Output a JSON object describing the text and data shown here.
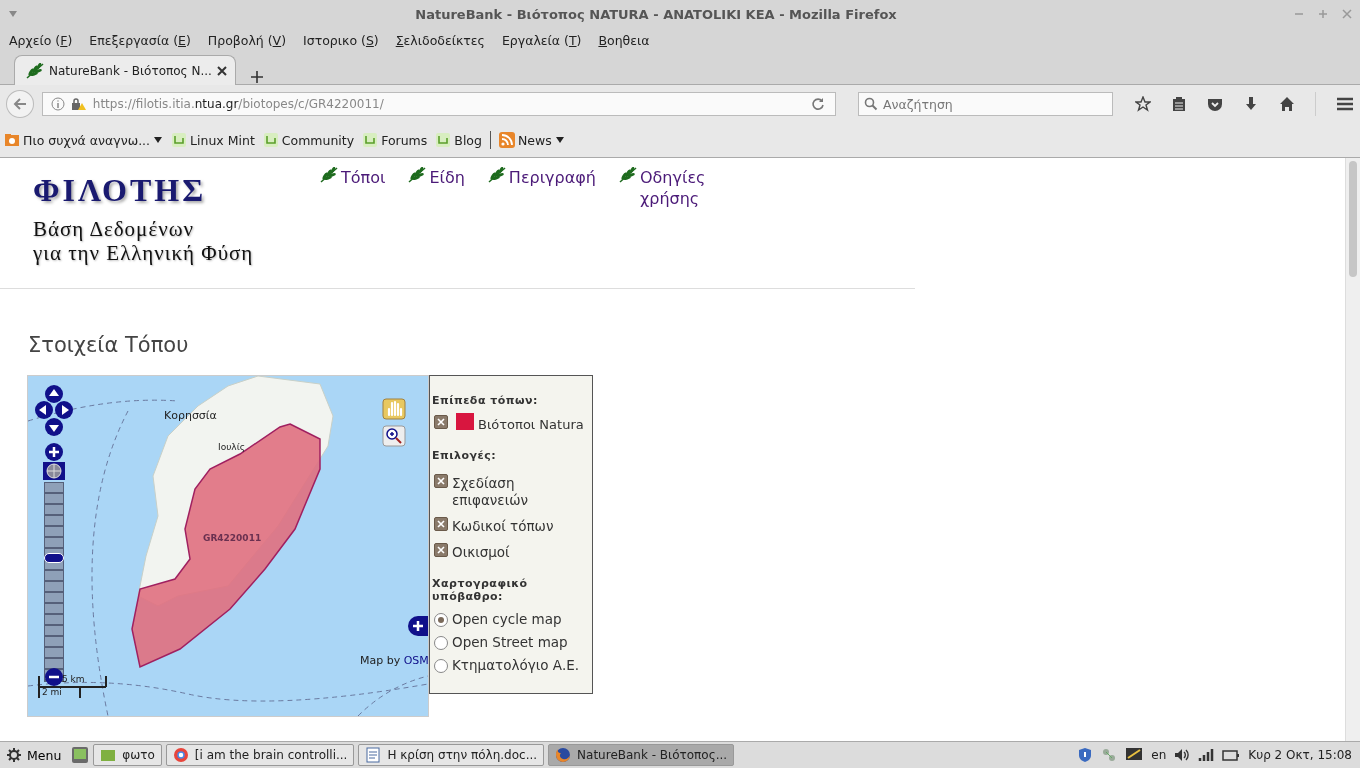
{
  "window": {
    "title": "NatureBank - Βιότοπος NATURA - ANATOLIKI KEA - Mozilla Firefox"
  },
  "menu": [
    {
      "before": "Αρχείο (",
      "key": "F",
      "after": ")"
    },
    {
      "before": "Επεξεργασία (",
      "key": "E",
      "after": ")"
    },
    {
      "before": "Προβολή (",
      "key": "V",
      "after": ")"
    },
    {
      "before": "Ιστορικο (",
      "key": "S",
      "after": ")"
    },
    {
      "key": "Σ",
      "after": "ελιδοδείκτες"
    },
    {
      "before": "Εργαλεία (",
      "key": "T",
      "after": ")"
    },
    {
      "key": "Β",
      "after": "οηθεια"
    }
  ],
  "tabs": [
    {
      "title": "NatureBank - Βιότοπος N...",
      "selected": true
    }
  ],
  "url": {
    "prefix": "https://filotis.itia.",
    "domain": "ntua.gr",
    "suffix": "/biotopes/c/GR4220011/"
  },
  "search": {
    "placeholder": "Αναζήτηση"
  },
  "bookmarks": [
    {
      "kind": "folder",
      "label": "Πιο συχνά αναγνω...",
      "dropdown": true
    },
    {
      "kind": "site",
      "label": "Linux Mint",
      "dropdown": false
    },
    {
      "kind": "site",
      "label": "Community",
      "dropdown": false
    },
    {
      "kind": "site",
      "label": "Forums",
      "dropdown": false
    },
    {
      "kind": "site",
      "label": "Blog",
      "dropdown": false
    },
    {
      "kind": "feed",
      "label": "News",
      "dropdown": true
    }
  ],
  "site": {
    "logo": "ΦΙΛΟΤΗΣ",
    "tagline_1": "Βάση Δεδομένων",
    "tagline_2": "για την Ελληνική Φύση",
    "nav": [
      "Τόποι",
      "Είδη",
      "Περιγραφή",
      "Οδηγίες χρήσης"
    ]
  },
  "heading": "Στοιχεία Τόπου",
  "map": {
    "places": [
      "Κορησσία",
      "Ιουλίς"
    ],
    "site_code": "GR4220011",
    "attribution_prefix": "Map by ",
    "attribution_link": "OSM",
    "scale_metric": "5 km",
    "scale_imperial": "2 mi",
    "zoom": {
      "level": 0.63
    }
  },
  "legend": {
    "layers_title": "Επίπεδα τόπων:",
    "layers": [
      {
        "label": "Βιότοποι Natura",
        "checked": true,
        "color": "#d8163f"
      }
    ],
    "options_title": "Επιλογές:",
    "options": [
      {
        "label": "Σχεδίαση επιφανειών",
        "checked": true
      },
      {
        "label": "Κωδικοί τόπων",
        "checked": true
      },
      {
        "label": "Οικισμοί",
        "checked": true
      }
    ],
    "base_title": "Χαρτογραφικό υπόβαθρο:",
    "bases": [
      {
        "label": "Open cycle map",
        "selected": true
      },
      {
        "label": "Open Street map",
        "selected": false
      },
      {
        "label": "Κτηματολόγιο Α.Ε.",
        "selected": false
      }
    ]
  },
  "taskbar": {
    "menu": "Menu",
    "windows": [
      {
        "kind": "folder",
        "label": "φωτο",
        "selected": false
      },
      {
        "kind": "browser",
        "label": "[i am the brain controlli...",
        "selected": false
      },
      {
        "kind": "document",
        "label": "Η κρίση στην πόλη.doc...",
        "selected": false
      },
      {
        "kind": "firefox",
        "label": "NatureBank - Βιότοπος...",
        "selected": true
      }
    ],
    "language": "en",
    "clock": "Κυρ  2 Οκτ, 15:08"
  }
}
